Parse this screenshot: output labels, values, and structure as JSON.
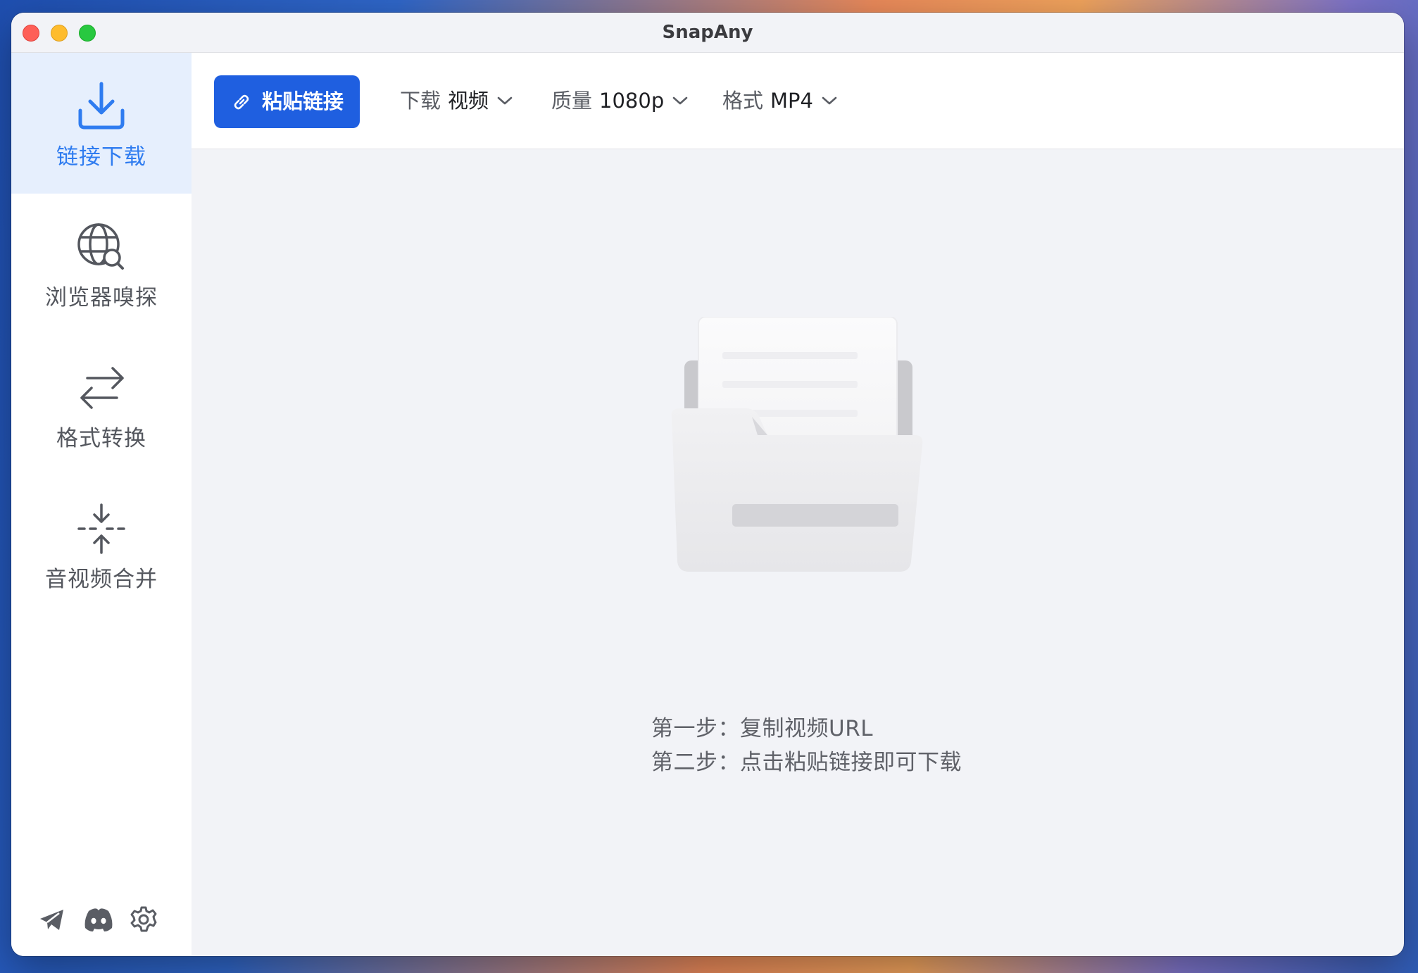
{
  "window": {
    "title": "SnapAny"
  },
  "sidebar": {
    "items": [
      {
        "label": "链接下载",
        "icon": "download-icon",
        "active": true
      },
      {
        "label": "浏览器嗅探",
        "icon": "globe-search-icon",
        "active": false
      },
      {
        "label": "格式转换",
        "icon": "swap-arrows-icon",
        "active": false
      },
      {
        "label": "音视频合并",
        "icon": "merge-icon",
        "active": false
      }
    ],
    "footer_icons": [
      "telegram-icon",
      "discord-icon",
      "gear-icon"
    ]
  },
  "toolbar": {
    "paste_label": "粘贴链接",
    "download_type": {
      "label": "下载",
      "value": "视频"
    },
    "quality": {
      "label": "质量",
      "value": "1080p"
    },
    "format": {
      "label": "格式",
      "value": "MP4"
    }
  },
  "empty_state": {
    "step1": "第一步：复制视频URL",
    "step2": "第二步：点击粘贴链接即可下载"
  },
  "colors": {
    "accent": "#1f5fe0",
    "active_bg": "#e6effd",
    "active_text": "#2f7cf0"
  }
}
